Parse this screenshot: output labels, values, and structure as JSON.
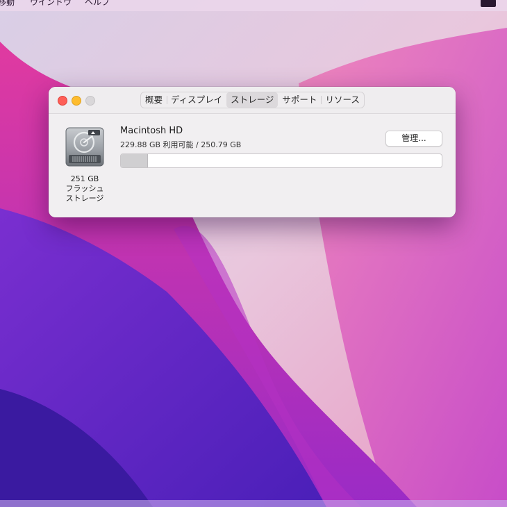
{
  "menubar": {
    "items": [
      "移動",
      "ウインドウ",
      "ヘルプ"
    ]
  },
  "window": {
    "tabs": [
      "概要",
      "ディスプレイ",
      "ストレージ",
      "サポート",
      "リソース"
    ],
    "active_tab": "ストレージ",
    "disk": {
      "icon": "hard-drive-icon",
      "capacity": "251 GB",
      "type_line1": "フラッシュ",
      "type_line2": "ストレージ"
    },
    "volume": {
      "name": "Macintosh HD",
      "usage_text": "229.88 GB 利用可能 / 250.79 GB",
      "used_fraction": 0.083
    },
    "manage_label": "管理..."
  },
  "colors": {
    "close": "#fe5f57",
    "minimize": "#febc2e",
    "zoom_disabled": "#d9d7d9"
  }
}
